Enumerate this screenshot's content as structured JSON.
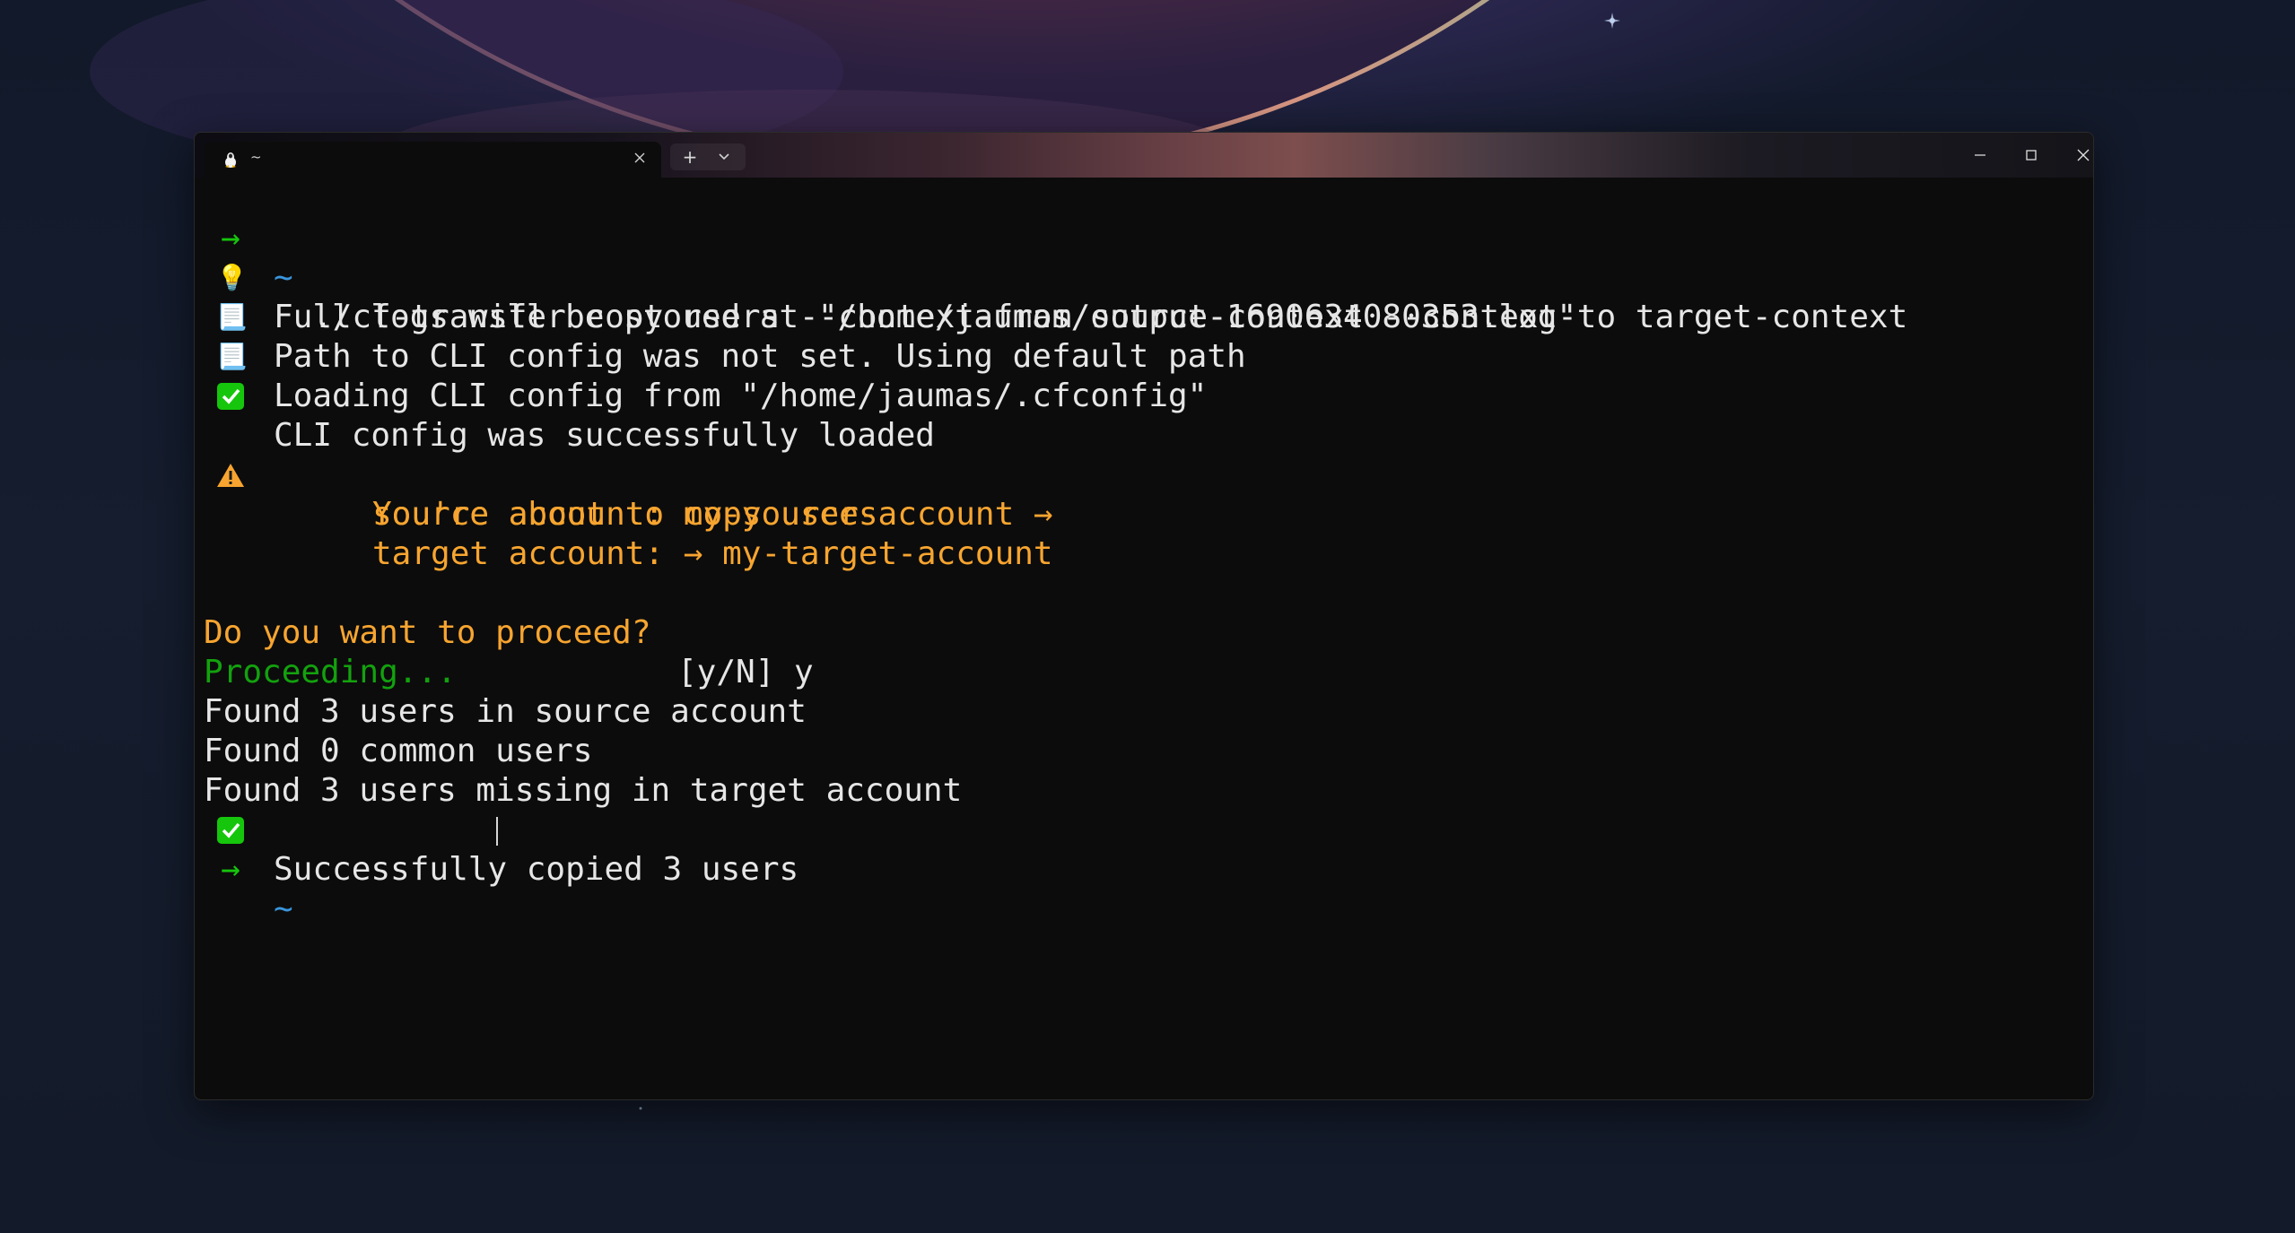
{
  "window": {
    "tab_title": "~",
    "tab_icon": "linux-tux-icon",
    "new_tab_label": "+"
  },
  "prompt": {
    "arrow": "→",
    "tilde": "~"
  },
  "lines": {
    "command": "./cf-transfer copy users --context-from source-context --context-to target-context",
    "logs": "Full logs will be stored at \"/home/jaumas/output-1690634080353.log\"",
    "path_not_set": "Path to CLI config was not set. Using default path",
    "loading_config": "Loading CLI config from \"/home/jaumas/.cfconfig\"",
    "config_loaded": "CLI config was successfully loaded",
    "warn_title": "You're about to copy users",
    "warn_source": "source account: my-source-account →",
    "warn_target": "target account: → my-target-account",
    "question": "Do you want to proceed?",
    "answer": "[y/N] y",
    "proceeding": "Proceeding...",
    "found_source": "Found 3 users in source account",
    "found_common": "Found 0 common users",
    "found_missing": "Found 3 users missing in target account",
    "copied": "Successfully copied 3 users"
  },
  "icons": {
    "bulb": "💡",
    "scroll": "📃",
    "check": "✅",
    "warning": "⚠"
  },
  "colors": {
    "prompt_arrow": "#16c60c",
    "tilde": "#3a96dd",
    "warning_text": "#f7a530",
    "proceeding": "#13a10e",
    "background": "#0c0c0c"
  }
}
